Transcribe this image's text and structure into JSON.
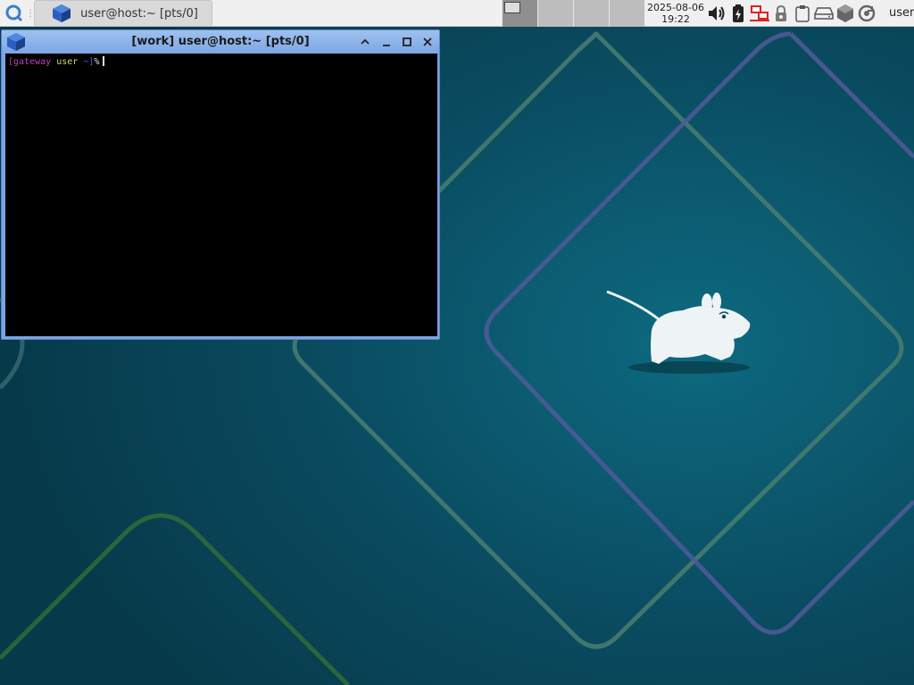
{
  "panel": {
    "taskbar_item": "user@host:~ [pts/0]",
    "workspaces": 4,
    "clock_date": "2025-08-06",
    "clock_time": "19:22",
    "user": "user",
    "tray_icons": [
      "volume-icon",
      "battery-icon",
      "network-icon",
      "lock-icon",
      "clipboard-icon",
      "drive-icon",
      "package-icon",
      "updates-icon"
    ]
  },
  "window": {
    "title": "[work] user@host:~ [pts/0]"
  },
  "terminal": {
    "prompt_host": "[gateway",
    "prompt_user": "user",
    "prompt_dir": "~]",
    "prompt_symbol": "%"
  },
  "colors": {
    "titlebar": "#7ca7e3",
    "prompt_host": "#c040c0",
    "prompt_user": "#d8d860",
    "prompt_dir": "#5a5aff",
    "desktop": "#0a4a5c"
  }
}
